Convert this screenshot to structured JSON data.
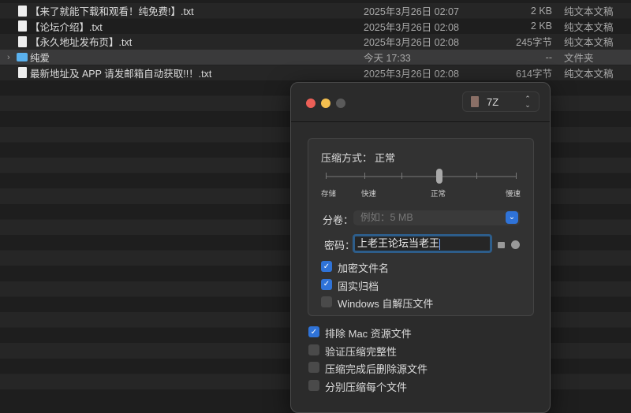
{
  "files": [
    {
      "name": "【来了就能下载和观看！纯免费!】.txt",
      "date": "2025年3月26日 02:07",
      "size": "2 KB",
      "kind": "纯文本文稿",
      "type": "file"
    },
    {
      "name": "【论坛介绍】.txt",
      "date": "2025年3月26日 02:08",
      "size": "2 KB",
      "kind": "纯文本文稿",
      "type": "file"
    },
    {
      "name": "【永久地址发布页】.txt",
      "date": "2025年3月26日 02:08",
      "size": "245字节",
      "kind": "纯文本文稿",
      "type": "file"
    },
    {
      "name": "纯爱",
      "date": "今天 17:33",
      "size": "--",
      "kind": "文件夹",
      "type": "folder",
      "chevron": "›"
    },
    {
      "name": "最新地址及 APP 请发邮箱自动获取!!！.txt",
      "date": "2025年3月26日 02:08",
      "size": "614字节",
      "kind": "纯文本文稿",
      "type": "file"
    }
  ],
  "dialog": {
    "format": "7Z",
    "format_arrows": "⌃⌄",
    "method_label": "压缩方式：",
    "method_value": "正常",
    "slider_labels": [
      "存储",
      "快速",
      "正常",
      "慢速"
    ],
    "slider_level": 3,
    "slider_steps": 6,
    "split_label": "分卷：",
    "split_placeholder": "例如：5 MB",
    "split_chevron": "⌄",
    "password_label": "密码：",
    "password_value": "上老王论坛当老王",
    "checkmark": "✓",
    "inner_options": [
      {
        "label": "加密文件名",
        "checked": true
      },
      {
        "label": "固实归档",
        "checked": true
      },
      {
        "label": "Windows 自解压文件",
        "checked": false
      }
    ],
    "outer_options": [
      {
        "label": "排除 Mac 资源文件",
        "checked": true
      },
      {
        "label": "验证压缩完整性",
        "checked": false
      },
      {
        "label": "压缩完成后删除源文件",
        "checked": false
      },
      {
        "label": "分别压缩每个文件",
        "checked": false
      }
    ]
  },
  "colors": {
    "accent": "#2f73d8",
    "close": "#ec5f57",
    "minimize": "#f4bf4f",
    "zoom": "#5a5a5a",
    "folder": "#5ab1ee"
  }
}
